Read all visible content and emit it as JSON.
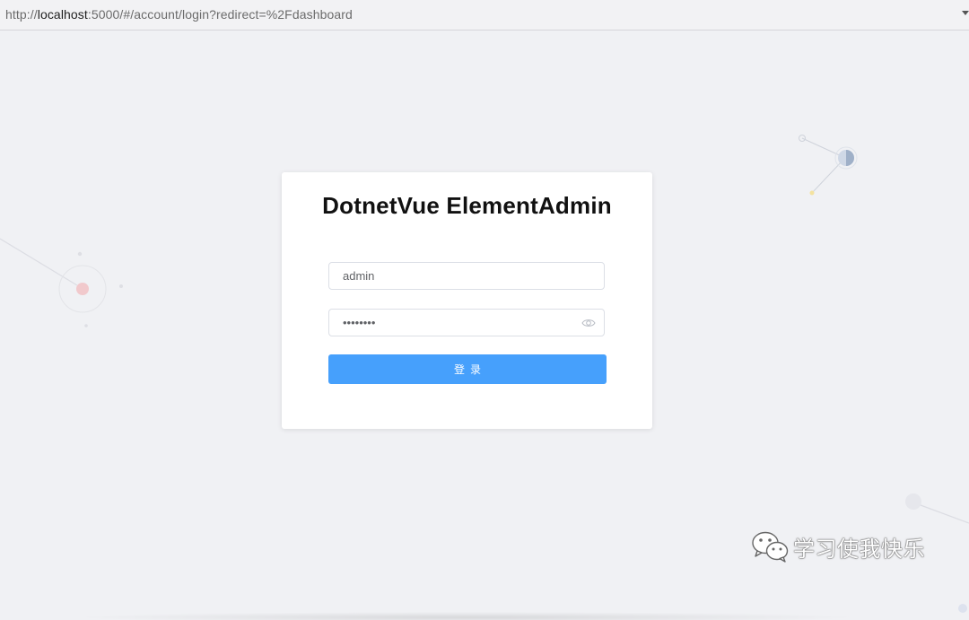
{
  "browser": {
    "url_prefix": "http://",
    "url_host": "localhost",
    "url_rest": ":5000/#/account/login?redirect=%2Fdashboard"
  },
  "login": {
    "title": "DotnetVue ElementAdmin",
    "username_value": "admin",
    "password_value": "••••••••",
    "submit_label": "登录"
  },
  "watermark": {
    "text": "学习使我快乐",
    "icon": "wechat-icon"
  },
  "colors": {
    "page_background": "#f0f1f4",
    "primary_button": "#46a0fc",
    "card_background": "#ffffff"
  }
}
